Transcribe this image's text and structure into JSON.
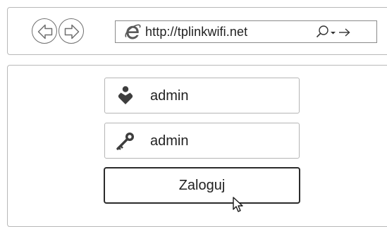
{
  "browser": {
    "url": "http://tplinkwifi.net",
    "back_icon": "arrow-left-icon",
    "forward_icon": "arrow-right-icon",
    "page_icon": "internet-explorer-icon",
    "search_icon": "search-icon",
    "dropdown_icon": "dropdown-icon",
    "go_icon": "go-arrow-icon"
  },
  "login": {
    "username_value": "admin",
    "username_icon": "user-icon",
    "password_value": "admin",
    "password_icon": "key-icon",
    "submit_label": "Zaloguj"
  },
  "cursor": {
    "icon": "mouse-pointer-icon"
  }
}
